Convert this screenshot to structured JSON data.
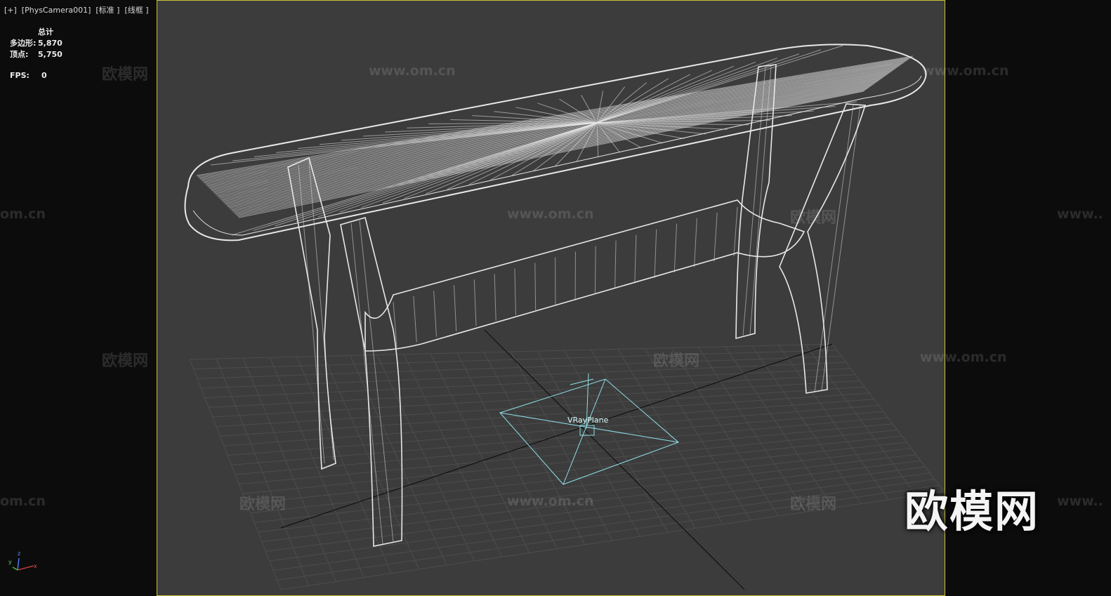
{
  "viewport_label": "[+]  [PhysCamera001]  [标准 ]  [线框 ]",
  "stats": {
    "header": "总计",
    "polygons_label": "多边形:",
    "polygons_value": "5,870",
    "vertices_label": "顶点:",
    "vertices_value": "5,750",
    "fps_label": "FPS:",
    "fps_value": "0"
  },
  "helper_label": "VRayPlane",
  "watermarks": {
    "brand": "欧模网",
    "url": "www.om.cn",
    "url_cut": "om.cn",
    "url_left": "www.."
  },
  "axis": {
    "x": "x",
    "y": "y",
    "z": "z"
  },
  "colors": {
    "viewport_border": "#c9c236",
    "viewport_bg": "#3c3c3c",
    "wire": "#ffffff",
    "helper": "#8fe0e8"
  }
}
